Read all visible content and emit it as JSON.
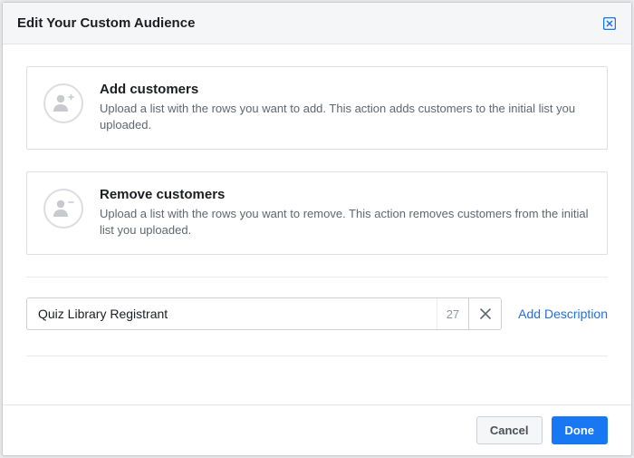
{
  "dialog": {
    "title": "Edit Your Custom Audience"
  },
  "options": {
    "add": {
      "title": "Add customers",
      "description": "Upload a list with the rows you want to add. This action adds customers to the initial list you uploaded."
    },
    "remove": {
      "title": "Remove customers",
      "description": "Upload a list with the rows you want to remove. This action removes customers from the initial list you uploaded."
    }
  },
  "nameField": {
    "value": "Quiz Library Registrant",
    "charCount": "27"
  },
  "actions": {
    "addDescription": "Add Description",
    "cancel": "Cancel",
    "done": "Done"
  }
}
